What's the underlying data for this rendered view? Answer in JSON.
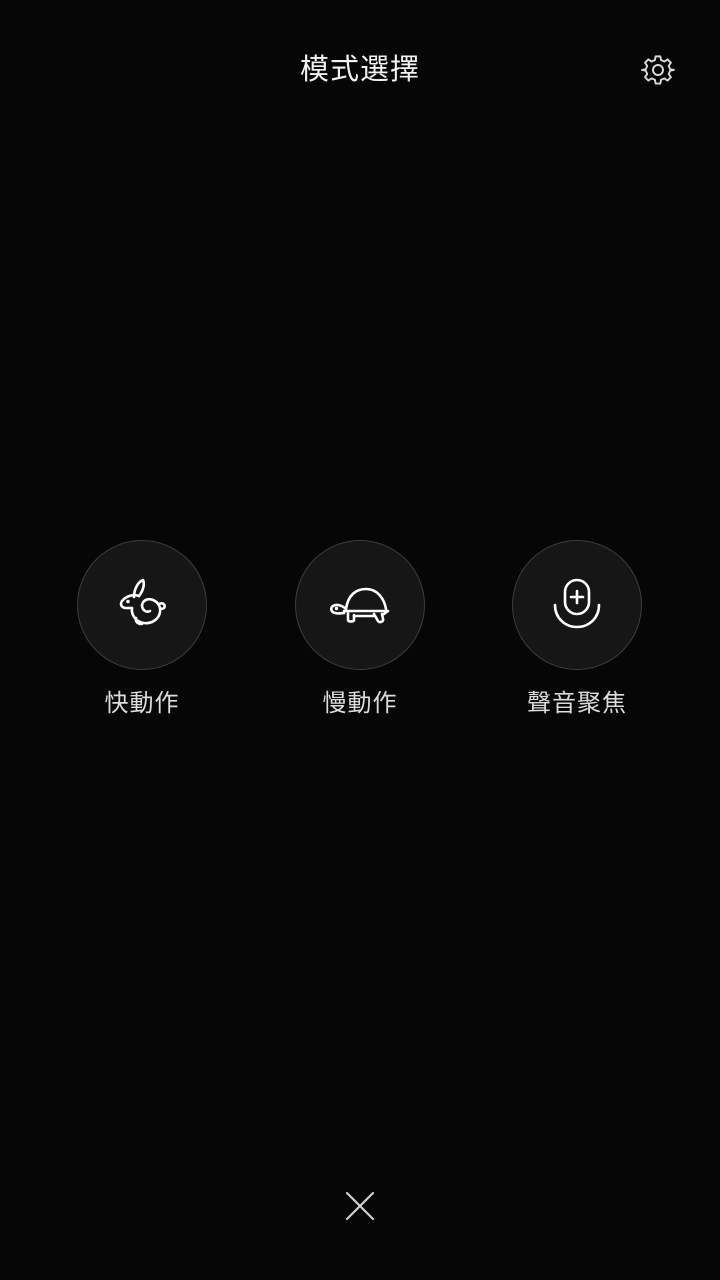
{
  "header": {
    "title": "模式選擇",
    "settings_icon": "gear-icon"
  },
  "modes": [
    {
      "label": "快動作",
      "icon": "rabbit-icon"
    },
    {
      "label": "慢動作",
      "icon": "turtle-icon"
    },
    {
      "label": "聲音聚焦",
      "icon": "audio-zoom-mic-icon"
    }
  ],
  "footer": {
    "close_icon": "close-icon"
  },
  "colors": {
    "background": "#060606",
    "circle_fill": "#161616",
    "circle_border": "#3d3d3d",
    "text": "#f2f2f2"
  }
}
